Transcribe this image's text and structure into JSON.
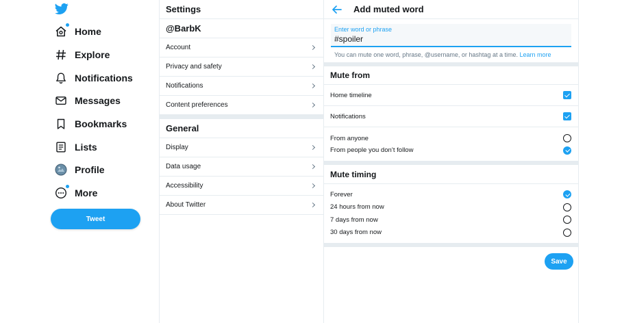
{
  "nav": {
    "items": [
      {
        "label": "Home",
        "icon": "home-icon"
      },
      {
        "label": "Explore",
        "icon": "hashtag-icon"
      },
      {
        "label": "Notifications",
        "icon": "bell-icon"
      },
      {
        "label": "Messages",
        "icon": "envelope-icon"
      },
      {
        "label": "Bookmarks",
        "icon": "bookmark-icon"
      },
      {
        "label": "Lists",
        "icon": "list-icon"
      },
      {
        "label": "Profile",
        "icon": "avatar-icon"
      },
      {
        "label": "More",
        "icon": "more-icon"
      }
    ],
    "tweet_label": "Tweet"
  },
  "settings": {
    "title": "Settings",
    "account_section": {
      "title": "@BarbK",
      "rows": [
        "Account",
        "Privacy and safety",
        "Notifications",
        "Content preferences"
      ]
    },
    "general_section": {
      "title": "General",
      "rows": [
        "Display",
        "Data usage",
        "Accessibility",
        "About Twitter"
      ]
    }
  },
  "mute": {
    "title": "Add muted word",
    "field_label": "Enter word or phrase",
    "field_value": "#spoiler",
    "hint": "You can mute one word, phrase, @username, or hashtag at a time.",
    "learn_more": "Learn more",
    "mute_from": {
      "title": "Mute from",
      "home_timeline": "Home timeline",
      "notifications": "Notifications",
      "from_anyone": "From anyone",
      "from_people": "From people you don’t follow"
    },
    "timing": {
      "title": "Mute timing",
      "options": [
        "Forever",
        "24 hours from now",
        "7 days from now",
        "30 days from now"
      ]
    },
    "save_label": "Save"
  },
  "colors": {
    "accent": "#1da1f2",
    "text": "#14171a",
    "divider": "#e6ecf0",
    "muted_text": "#657786"
  }
}
